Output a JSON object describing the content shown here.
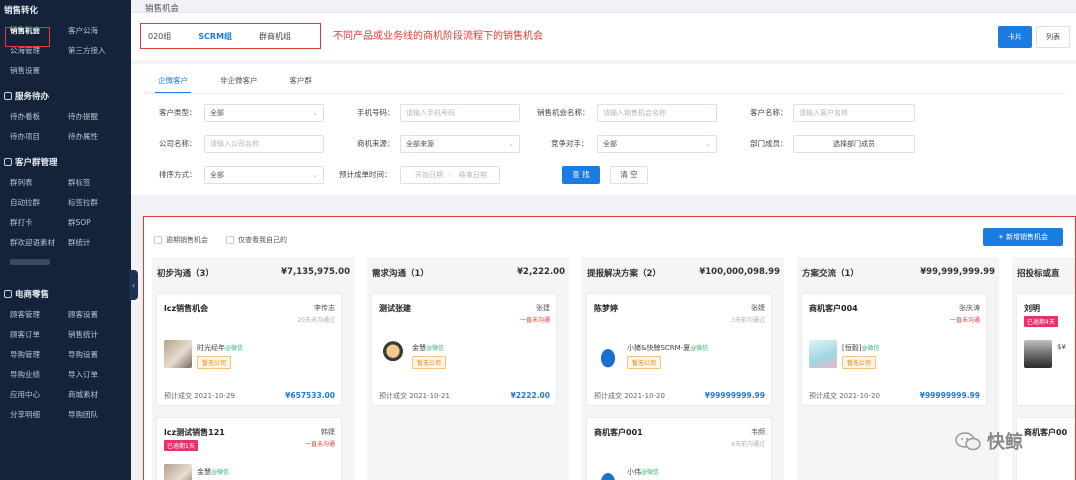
{
  "sidebar": {
    "sections": [
      {
        "title": "销售转化",
        "rows": [
          [
            "销售机会",
            "客户公海"
          ],
          [
            "公海管理",
            "第三方接入"
          ],
          [
            "销售设置",
            ""
          ]
        ]
      },
      {
        "title": "服务待办",
        "rows": [
          [
            "待办看板",
            "待办提醒"
          ],
          [
            "待办项目",
            "待办属性"
          ]
        ]
      },
      {
        "title": "客户群管理",
        "rows": [
          [
            "群列表",
            "群标签"
          ],
          [
            "自动拉群",
            "标签拉群"
          ],
          [
            "群打卡",
            "群SOP"
          ],
          [
            "群欢迎语素材",
            "群统计"
          ]
        ]
      },
      {
        "title": "电商零售",
        "rows": [
          [
            "顾客管理",
            "顾客设置"
          ],
          [
            "顾客订单",
            "销售统计"
          ],
          [
            "导购管理",
            "导购设置"
          ],
          [
            "导购业绩",
            "导入订单"
          ],
          [
            "应用中心",
            "商城素材"
          ],
          [
            "分享明细",
            "导购团队"
          ]
        ]
      }
    ],
    "toggle_icon": "‹"
  },
  "header": {
    "page_title": "销售机会"
  },
  "groups": {
    "tabs": [
      "020组",
      "SCRM组",
      "群商机组"
    ],
    "active_index": 1,
    "annotation": "不同产品或业务线的商机阶段流程下的销售机会",
    "view_card": "卡片",
    "view_list": "列表"
  },
  "filters": {
    "tabs": [
      "企微客户",
      "非企微客户",
      "客户群"
    ],
    "customer_type": {
      "label": "客户类型：",
      "value": "全部"
    },
    "phone": {
      "label": "手机号码：",
      "placeholder": "请输入手机号码"
    },
    "opportunity_name": {
      "label": "销售机会名称：",
      "placeholder": "请输入销售机会名称"
    },
    "customer_name": {
      "label": "客户名称：",
      "placeholder": "请输入客户名称"
    },
    "company_name": {
      "label": "公司名称：",
      "placeholder": "请输入公司名称"
    },
    "source": {
      "label": "商机来源：",
      "value": "全部来源"
    },
    "competitor": {
      "label": "竞争对手：",
      "value": "全部"
    },
    "department": {
      "label": "部门成员：",
      "value": "选择部门成员"
    },
    "sort": {
      "label": "排序方式：",
      "value": "全部"
    },
    "close_time": {
      "label": "预计成单时间：",
      "start": "开始日期",
      "sep": "-",
      "end": "结束日期"
    },
    "query": "查 找",
    "clear": "清 空"
  },
  "kanban": {
    "checks": [
      "逾期销售机会",
      "仅查看我自己的"
    ],
    "new_button": "+ 新增销售机会",
    "columns": [
      {
        "name": "初步沟通（3）",
        "amount": "¥7,135,975.00",
        "cards": [
          {
            "title": "lcz销售机会",
            "owner": "李传志",
            "status": "20天未沟通过",
            "status_red": false,
            "contact": "时光经年",
            "wechat": "@微信",
            "company": "暂无公司",
            "date": "预计成交 2021-10-29",
            "value": "¥657533.00"
          },
          {
            "title": "lcz测试销售121",
            "owner": "韩婕",
            "status": "一直未沟通",
            "status_red": true,
            "badge": "已逾期1天",
            "contact": "金慧",
            "wechat": "@微信"
          }
        ]
      },
      {
        "name": "需求沟通（1）",
        "amount": "¥2,222.00",
        "cards": [
          {
            "title": "测试张建",
            "owner": "张建",
            "status": "一直未沟通",
            "status_red": true,
            "contact": "金慧",
            "wechat": "@微信",
            "company": "暂无公司",
            "date": "预计成交 2021-10-21",
            "value": "¥2222.00"
          }
        ]
      },
      {
        "name": "提报解决方案（2）",
        "amount": "¥100,000,098.99",
        "cards": [
          {
            "title": "陈梦婷",
            "owner": "张婕",
            "status": "3天前沟通过",
            "status_red": false,
            "contact": "小猪&快鲸SCRM-夏",
            "wechat": "@微信",
            "company": "暂无公司",
            "date": "预计成交 2021-10-20",
            "value": "¥99999999.99"
          },
          {
            "title": "商机客户001",
            "owner": "韦频",
            "status": "4天前沟通过",
            "status_red": false,
            "contact": "小伟",
            "wechat": "@微信"
          }
        ]
      },
      {
        "name": "方案交流（1）",
        "amount": "¥99,999,999.99",
        "cards": [
          {
            "title": "商机客户004",
            "owner": "张庆涛",
            "status": "一直未沟通",
            "status_red": true,
            "contact": "[恒毅]",
            "wechat": "@微信",
            "company": "暂无公司",
            "date": "预计成交 2021-10-20",
            "value": "¥99999999.99"
          }
        ]
      },
      {
        "name": "招投标或直",
        "amount": "",
        "cards": [
          {
            "title": "刘明",
            "owner": "",
            "status": "",
            "status_red": false,
            "badge": "已逾期4天",
            "contact": "$¥",
            "wechat": ""
          },
          {
            "title": "商机客户00",
            "owner": "",
            "status": "",
            "status_red": false,
            "contact": "",
            "wechat": ""
          }
        ]
      }
    ]
  },
  "watermark": {
    "text": "快鲸"
  },
  "colors": {
    "accent": "#1a7be2",
    "sidebar_bg": "#14233a",
    "highlight_red": "#e53935",
    "overdue_badge": "#e8306b",
    "company_tag": "#e08a18"
  }
}
